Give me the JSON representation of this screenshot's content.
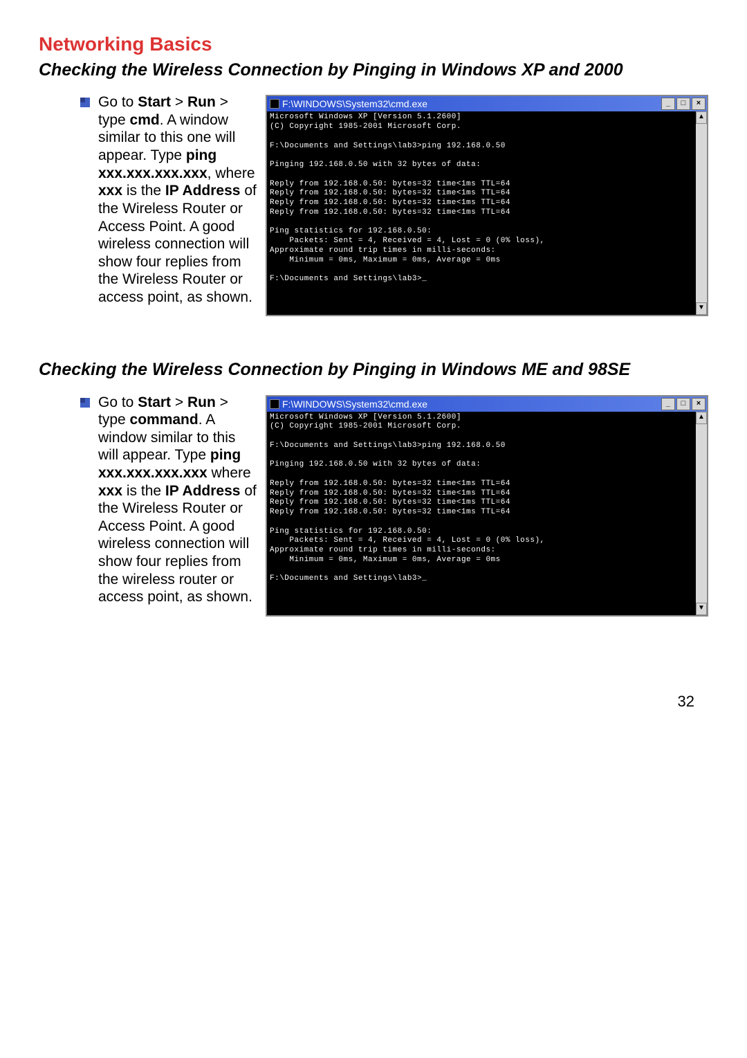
{
  "heading": "Networking Basics",
  "subheading1": "Checking the Wireless Connection by Pinging in Windows XP and 2000",
  "subheading2": "Checking the Wireless Connection by Pinging in Windows ME and 98SE",
  "step1": {
    "t1": "Go to ",
    "b1": "Start",
    "t2": " > ",
    "b2": "Run",
    "t3": " > type ",
    "b3": "cmd",
    "t4": ".  A window similar to this one will appear.  Type ",
    "b4": "ping xxx.xxx.xxx.xxx",
    "t5": ", where ",
    "b5": "xxx",
    "t6": " is the ",
    "b6": "IP Address",
    "t7": " of the Wireless Router or Access Point.  A good wireless connection will show four replies from the Wireless Router or access point, as shown."
  },
  "step2": {
    "t1": "Go to ",
    "b1": "Start",
    "t2": " > ",
    "b2": "Run",
    "t3": " > type ",
    "b3": "command",
    "t4": ".  A window similar to this will appear.  Type ",
    "b4": "ping xxx.xxx.xxx.xxx",
    "t5": " where ",
    "b5": "xxx",
    "t6": " is the ",
    "b6": "IP Address",
    "t7": " of the Wireless Router or Access Point.  A good wireless connection will show four replies from the wireless router or access point, as shown."
  },
  "cmd": {
    "title": "F:\\WINDOWS\\System32\\cmd.exe",
    "min": "_",
    "max": "□",
    "close": "×",
    "up": "▲",
    "down": "▼",
    "lines": "Microsoft Windows XP [Version 5.1.2600]\n(C) Copyright 1985-2001 Microsoft Corp.\n\nF:\\Documents and Settings\\lab3>ping 192.168.0.50\n\nPinging 192.168.0.50 with 32 bytes of data:\n\nReply from 192.168.0.50: bytes=32 time<1ms TTL=64\nReply from 192.168.0.50: bytes=32 time<1ms TTL=64\nReply from 192.168.0.50: bytes=32 time<1ms TTL=64\nReply from 192.168.0.50: bytes=32 time<1ms TTL=64\n\nPing statistics for 192.168.0.50:\n    Packets: Sent = 4, Received = 4, Lost = 0 (0% loss),\nApproximate round trip times in milli-seconds:\n    Minimum = 0ms, Maximum = 0ms, Average = 0ms\n\nF:\\Documents and Settings\\lab3>_"
  },
  "page_number": "32"
}
